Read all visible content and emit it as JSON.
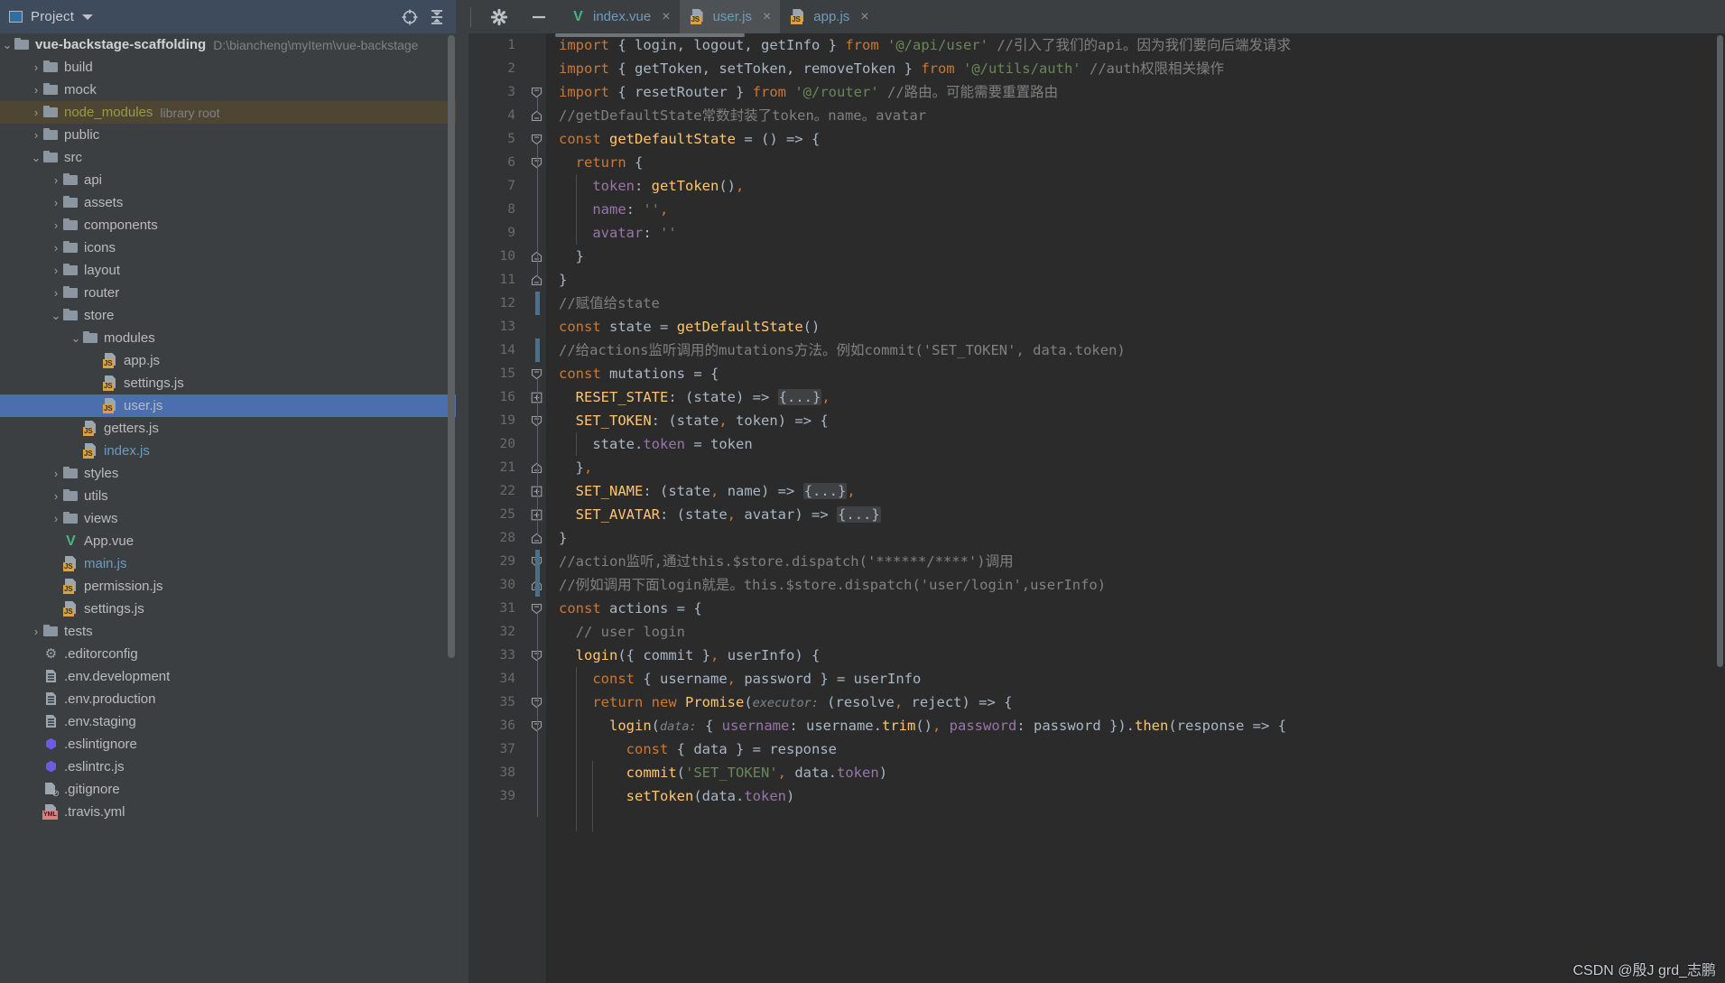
{
  "tool_window": {
    "title": "Project",
    "icons": [
      "project-window-icon",
      "chevron-down-icon",
      "locate-icon",
      "collapse-all-icon",
      "settings-icon",
      "hide-icon"
    ]
  },
  "project_tree": {
    "root": {
      "label": "vue-backstage-scaffolding",
      "path": "D:\\biancheng\\myItem\\vue-backstage"
    },
    "items": [
      {
        "label": "build",
        "indent": 1,
        "kind": "folder",
        "arrow": "collapsed"
      },
      {
        "label": "mock",
        "indent": 1,
        "kind": "folder",
        "arrow": "collapsed"
      },
      {
        "label": "node_modules",
        "indent": 1,
        "kind": "folder",
        "arrow": "collapsed",
        "suffix": "library root",
        "style": "library"
      },
      {
        "label": "public",
        "indent": 1,
        "kind": "folder",
        "arrow": "collapsed"
      },
      {
        "label": "src",
        "indent": 1,
        "kind": "folder",
        "arrow": "expanded"
      },
      {
        "label": "api",
        "indent": 2,
        "kind": "folder",
        "arrow": "collapsed"
      },
      {
        "label": "assets",
        "indent": 2,
        "kind": "folder",
        "arrow": "collapsed"
      },
      {
        "label": "components",
        "indent": 2,
        "kind": "folder",
        "arrow": "collapsed"
      },
      {
        "label": "icons",
        "indent": 2,
        "kind": "folder",
        "arrow": "collapsed"
      },
      {
        "label": "layout",
        "indent": 2,
        "kind": "folder",
        "arrow": "collapsed"
      },
      {
        "label": "router",
        "indent": 2,
        "kind": "folder",
        "arrow": "collapsed"
      },
      {
        "label": "store",
        "indent": 2,
        "kind": "folder",
        "arrow": "expanded"
      },
      {
        "label": "modules",
        "indent": 3,
        "kind": "folder",
        "arrow": "expanded"
      },
      {
        "label": "app.js",
        "indent": 4,
        "kind": "js",
        "arrow": "none"
      },
      {
        "label": "settings.js",
        "indent": 4,
        "kind": "js",
        "arrow": "none"
      },
      {
        "label": "user.js",
        "indent": 4,
        "kind": "js",
        "arrow": "none",
        "selected": true
      },
      {
        "label": "getters.js",
        "indent": 3,
        "kind": "js",
        "arrow": "none"
      },
      {
        "label": "index.js",
        "indent": 3,
        "kind": "js",
        "arrow": "none",
        "style": "blue"
      },
      {
        "label": "styles",
        "indent": 2,
        "kind": "folder",
        "arrow": "collapsed"
      },
      {
        "label": "utils",
        "indent": 2,
        "kind": "folder",
        "arrow": "collapsed"
      },
      {
        "label": "views",
        "indent": 2,
        "kind": "folder",
        "arrow": "collapsed"
      },
      {
        "label": "App.vue",
        "indent": 2,
        "kind": "vue",
        "arrow": "none"
      },
      {
        "label": "main.js",
        "indent": 2,
        "kind": "js",
        "arrow": "none",
        "style": "blue"
      },
      {
        "label": "permission.js",
        "indent": 2,
        "kind": "js",
        "arrow": "none"
      },
      {
        "label": "settings.js",
        "indent": 2,
        "kind": "js",
        "arrow": "none"
      },
      {
        "label": "tests",
        "indent": 1,
        "kind": "folder",
        "arrow": "collapsed"
      },
      {
        "label": ".editorconfig",
        "indent": 1,
        "kind": "gear",
        "arrow": "none"
      },
      {
        "label": ".env.development",
        "indent": 1,
        "kind": "file",
        "arrow": "none"
      },
      {
        "label": ".env.production",
        "indent": 1,
        "kind": "file",
        "arrow": "none"
      },
      {
        "label": ".env.staging",
        "indent": 1,
        "kind": "file",
        "arrow": "none"
      },
      {
        "label": ".eslintignore",
        "indent": 1,
        "kind": "eslint",
        "arrow": "none"
      },
      {
        "label": ".eslintrc.js",
        "indent": 1,
        "kind": "eslint",
        "arrow": "none"
      },
      {
        "label": ".gitignore",
        "indent": 1,
        "kind": "git",
        "arrow": "none"
      },
      {
        "label": ".travis.yml",
        "indent": 1,
        "kind": "yml",
        "arrow": "none"
      }
    ]
  },
  "editor_tabs": [
    {
      "label": "index.vue",
      "kind": "vue",
      "active": false,
      "close": "×"
    },
    {
      "label": "user.js",
      "kind": "js",
      "active": true,
      "close": "×"
    },
    {
      "label": "app.js",
      "kind": "js",
      "active": false,
      "close": "×"
    }
  ],
  "code": {
    "lines": [
      {
        "n": "1",
        "fold": "none",
        "change": false,
        "html": "<span class=\"kw\">import</span> { <span class=\"ident\">login</span>, <span class=\"ident\">logout</span>, <span class=\"ident\">getInfo</span> } <span class=\"kw\">from</span> <span class=\"str\">'@/api/user'</span> <span class=\"cmt\">//引入了我们的api。因为我们要向后端发请求</span>"
      },
      {
        "n": "2",
        "fold": "none",
        "change": false,
        "html": "<span class=\"kw\">import</span> { <span class=\"ident\">getToken</span>, <span class=\"ident\">setToken</span>, <span class=\"ident\">removeToken</span> } <span class=\"kw\">from</span> <span class=\"str\">'@/utils/auth'</span> <span class=\"cmt\">//auth权限相关操作</span>"
      },
      {
        "n": "3",
        "fold": "open",
        "change": false,
        "html": "<span class=\"kw\">import</span> { <span class=\"ident\">resetRouter</span> } <span class=\"kw\">from</span> <span class=\"str\">'@/router'</span> <span class=\"cmt\">//路由。可能需要重置路由</span>"
      },
      {
        "n": "4",
        "fold": "close",
        "change": false,
        "html": "<span class=\"cmt\">//getDefaultState常数封装了token。name。avatar</span>"
      },
      {
        "n": "5",
        "fold": "open",
        "change": false,
        "html": "<span class=\"kw\">const</span> <span class=\"fn\">getDefaultState</span> = () =&gt; {"
      },
      {
        "n": "6",
        "fold": "open",
        "change": false,
        "html": "  <span class=\"kw\">return</span> {"
      },
      {
        "n": "7",
        "fold": "none",
        "change": false,
        "html": "    <span class=\"prop\">token</span>: <span class=\"fn\">getToken</span>()<span class=\"kw\">,</span>"
      },
      {
        "n": "8",
        "fold": "none",
        "change": false,
        "html": "    <span class=\"prop\">name</span>: <span class=\"str\">''</span><span class=\"kw\">,</span>"
      },
      {
        "n": "9",
        "fold": "none",
        "change": false,
        "html": "    <span class=\"prop\">avatar</span>: <span class=\"str\">''</span>"
      },
      {
        "n": "10",
        "fold": "close",
        "change": false,
        "html": "  }"
      },
      {
        "n": "11",
        "fold": "close",
        "change": false,
        "html": "}"
      },
      {
        "n": "12",
        "fold": "none",
        "change": true,
        "html": "<span class=\"cmt\">//赋值给state</span>"
      },
      {
        "n": "13",
        "fold": "none",
        "change": false,
        "html": "<span class=\"kw\">const</span> <span class=\"ident\">state</span> = <span class=\"fn\">getDefaultState</span>()"
      },
      {
        "n": "14",
        "fold": "none",
        "change": true,
        "html": "<span class=\"cmt\">//给actions监听调用的mutations方法。例如commit('SET_TOKEN', data.token)</span>"
      },
      {
        "n": "15",
        "fold": "open",
        "change": false,
        "html": "<span class=\"kw\">const</span> <span class=\"ident\">mutations</span> = {"
      },
      {
        "n": "16",
        "fold": "plus",
        "change": false,
        "html": "  <span class=\"fn\">RESET_STATE</span>: (<span class=\"ident\">state</span>) =&gt; <span class=\"fold-ph\">{...}</span><span class=\"kw\">,</span>"
      },
      {
        "n": "19",
        "fold": "open",
        "change": false,
        "html": "  <span class=\"fn\">SET_TOKEN</span>: (<span class=\"ident\">state</span><span class=\"kw\">,</span> <span class=\"ident\">token</span>) =&gt; {"
      },
      {
        "n": "20",
        "fold": "none",
        "change": false,
        "html": "    <span class=\"ident\">state</span>.<span class=\"prop\">token</span> = <span class=\"ident\">token</span>"
      },
      {
        "n": "21",
        "fold": "close",
        "change": false,
        "html": "  }<span class=\"kw\">,</span>"
      },
      {
        "n": "22",
        "fold": "plus",
        "change": false,
        "html": "  <span class=\"fn\">SET_NAME</span>: (<span class=\"ident\">state</span><span class=\"kw\">,</span> <span class=\"ident\">name</span>) =&gt; <span class=\"fold-ph\">{...}</span><span class=\"kw\">,</span>"
      },
      {
        "n": "25",
        "fold": "plus",
        "change": false,
        "html": "  <span class=\"fn\">SET_AVATAR</span>: (<span class=\"ident\">state</span><span class=\"kw\">,</span> <span class=\"ident\">avatar</span>) =&gt; <span class=\"fold-ph\">{...}</span>"
      },
      {
        "n": "28",
        "fold": "close",
        "change": false,
        "html": "}"
      },
      {
        "n": "29",
        "fold": "open",
        "change": true,
        "html": "<span class=\"cmt\">//action监听,通过this.$store.dispatch('******/****')调用</span>"
      },
      {
        "n": "30",
        "fold": "close",
        "change": true,
        "html": "<span class=\"cmt\">//例如调用下面login就是。this.$store.dispatch('user/login',userInfo)</span>"
      },
      {
        "n": "31",
        "fold": "open",
        "change": false,
        "html": "<span class=\"kw\">const</span> <span class=\"ident\">actions</span> = {"
      },
      {
        "n": "32",
        "fold": "none",
        "change": false,
        "html": "  <span class=\"cmt\">// user login</span>"
      },
      {
        "n": "33",
        "fold": "open",
        "change": false,
        "html": "  <span class=\"fn\">login</span>({ <span class=\"ident\">commit</span> }<span class=\"kw\">,</span> <span class=\"ident\">userInfo</span>) {"
      },
      {
        "n": "34",
        "fold": "none",
        "change": false,
        "html": "    <span class=\"kw\">const</span> { <span class=\"ident\">username</span><span class=\"kw\">,</span> <span class=\"ident\">password</span> } = <span class=\"ident\">userInfo</span>"
      },
      {
        "n": "35",
        "fold": "open",
        "change": false,
        "html": "    <span class=\"kw\">return new</span> <span class=\"fn\">Promise</span>(<span class=\"hint\">executor:</span> (<span class=\"ident\">resolve</span><span class=\"kw\">,</span> <span class=\"ident\">reject</span>) =&gt; {"
      },
      {
        "n": "36",
        "fold": "open",
        "change": false,
        "html": "      <span class=\"fn\">login</span>(<span class=\"hint\">data:</span> { <span class=\"prop\">username</span>: <span class=\"ident\">username</span>.<span class=\"fn\">trim</span>()<span class=\"kw\">,</span> <span class=\"prop\">password</span>: <span class=\"ident\">password</span> }).<span class=\"fn\">then</span>(<span class=\"ident\">response</span> =&gt; {"
      },
      {
        "n": "37",
        "fold": "none",
        "change": false,
        "html": "        <span class=\"kw\">const</span> { <span class=\"ident\">data</span> } = <span class=\"ident\">response</span>"
      },
      {
        "n": "38",
        "fold": "none",
        "change": false,
        "html": "        <span class=\"fn\">commit</span>(<span class=\"str\">'SET_TOKEN'</span><span class=\"kw\">,</span> <span class=\"ident\">data</span>.<span class=\"prop\">token</span>)"
      },
      {
        "n": "39",
        "fold": "none",
        "change": false,
        "html": "        <span class=\"fn\">setToken</span>(<span class=\"ident\">data</span>.<span class=\"prop\">token</span>)"
      }
    ]
  },
  "watermark": "CSDN @殷J grd_志鹏",
  "colors": {
    "selection": "#4b6eaf",
    "library_root": "#4e4632",
    "editor_bg": "#2b2b2b",
    "gutter_bg": "#313335",
    "panel_bg": "#3c3f41",
    "header_bg": "#3d4b5c",
    "keyword": "#cc7832",
    "function": "#ffc66d",
    "string": "#6a8759",
    "comment": "#808080",
    "property": "#9876aa",
    "default_text": "#a9b7c6"
  }
}
